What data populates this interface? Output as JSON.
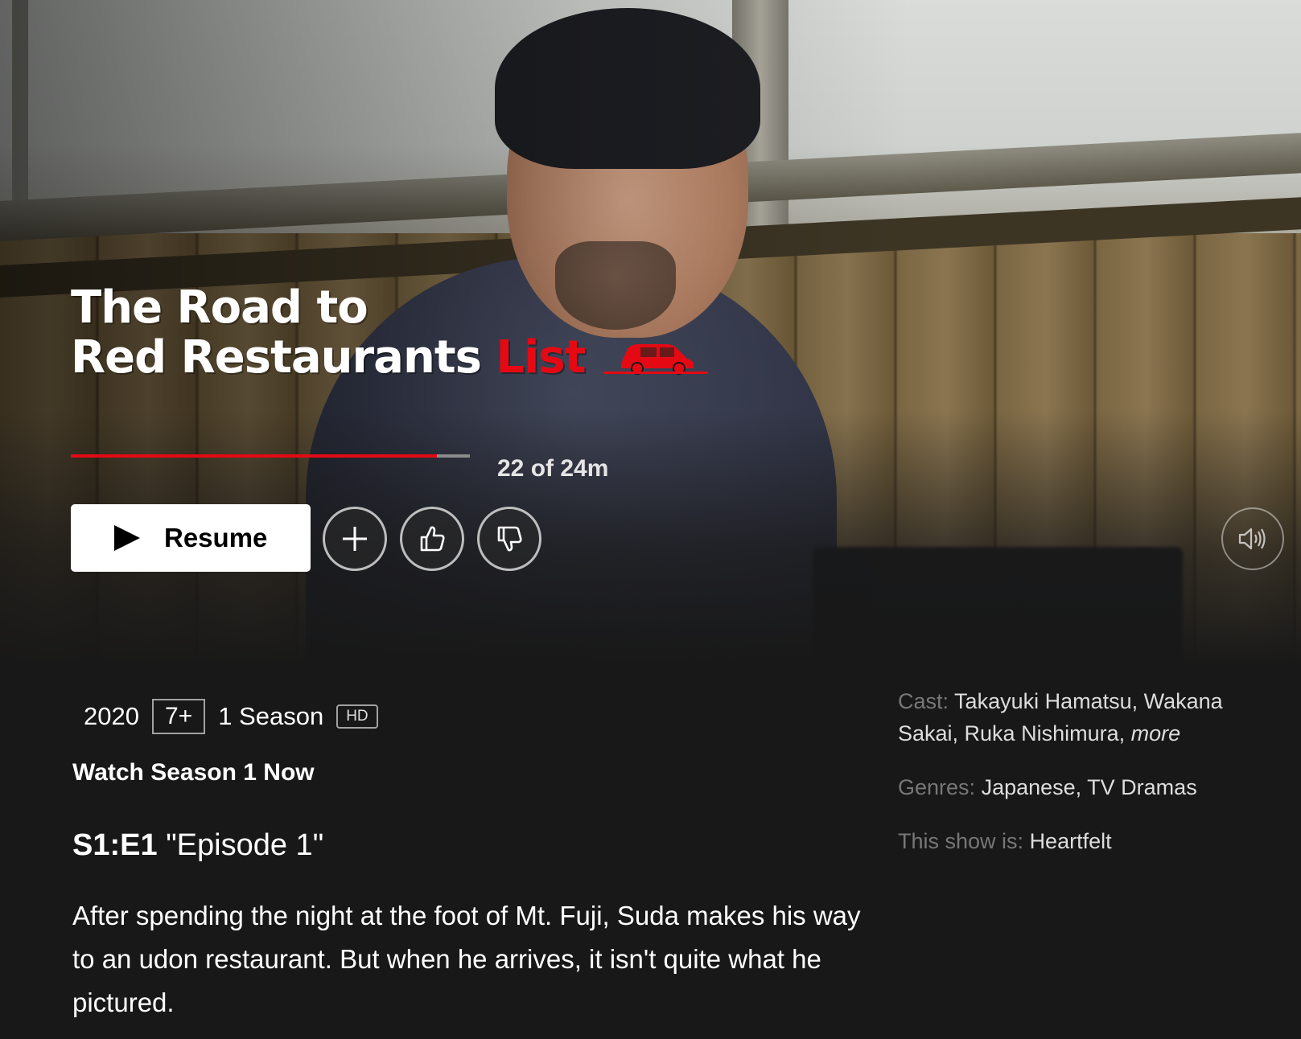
{
  "title": {
    "line1": "The Road to",
    "line2_white": "Red Restaurants",
    "line2_red": "List"
  },
  "progress": {
    "watched_fraction": 0.917,
    "label": "22 of 24m"
  },
  "actions": {
    "resume_label": "Resume",
    "add_icon": "plus-icon",
    "like_icon": "thumbs-up-icon",
    "dislike_icon": "thumbs-down-icon",
    "mute_icon": "volume-icon"
  },
  "meta": {
    "year": "2020",
    "maturity": "7+",
    "seasons": "1 Season",
    "quality": "HD"
  },
  "watch_now": "Watch Season 1 Now",
  "episode": {
    "number": "S1:E1",
    "title": "\"Episode 1\"",
    "synopsis": "After spending the night at the foot of Mt. Fuji, Suda makes his way to an udon restaurant. But when he arrives, it isn't quite what he pictured."
  },
  "details": {
    "cast_label": "Cast:",
    "cast_value": "Takayuki Hamatsu, Wakana Sakai, Ruka Nishimura,",
    "cast_more": "more",
    "genres_label": "Genres:",
    "genres_value": "Japanese, TV Dramas",
    "show_is_label": "This show is:",
    "show_is_value": "Heartfelt"
  },
  "colors": {
    "accent": "#e50914",
    "background": "#181818"
  }
}
